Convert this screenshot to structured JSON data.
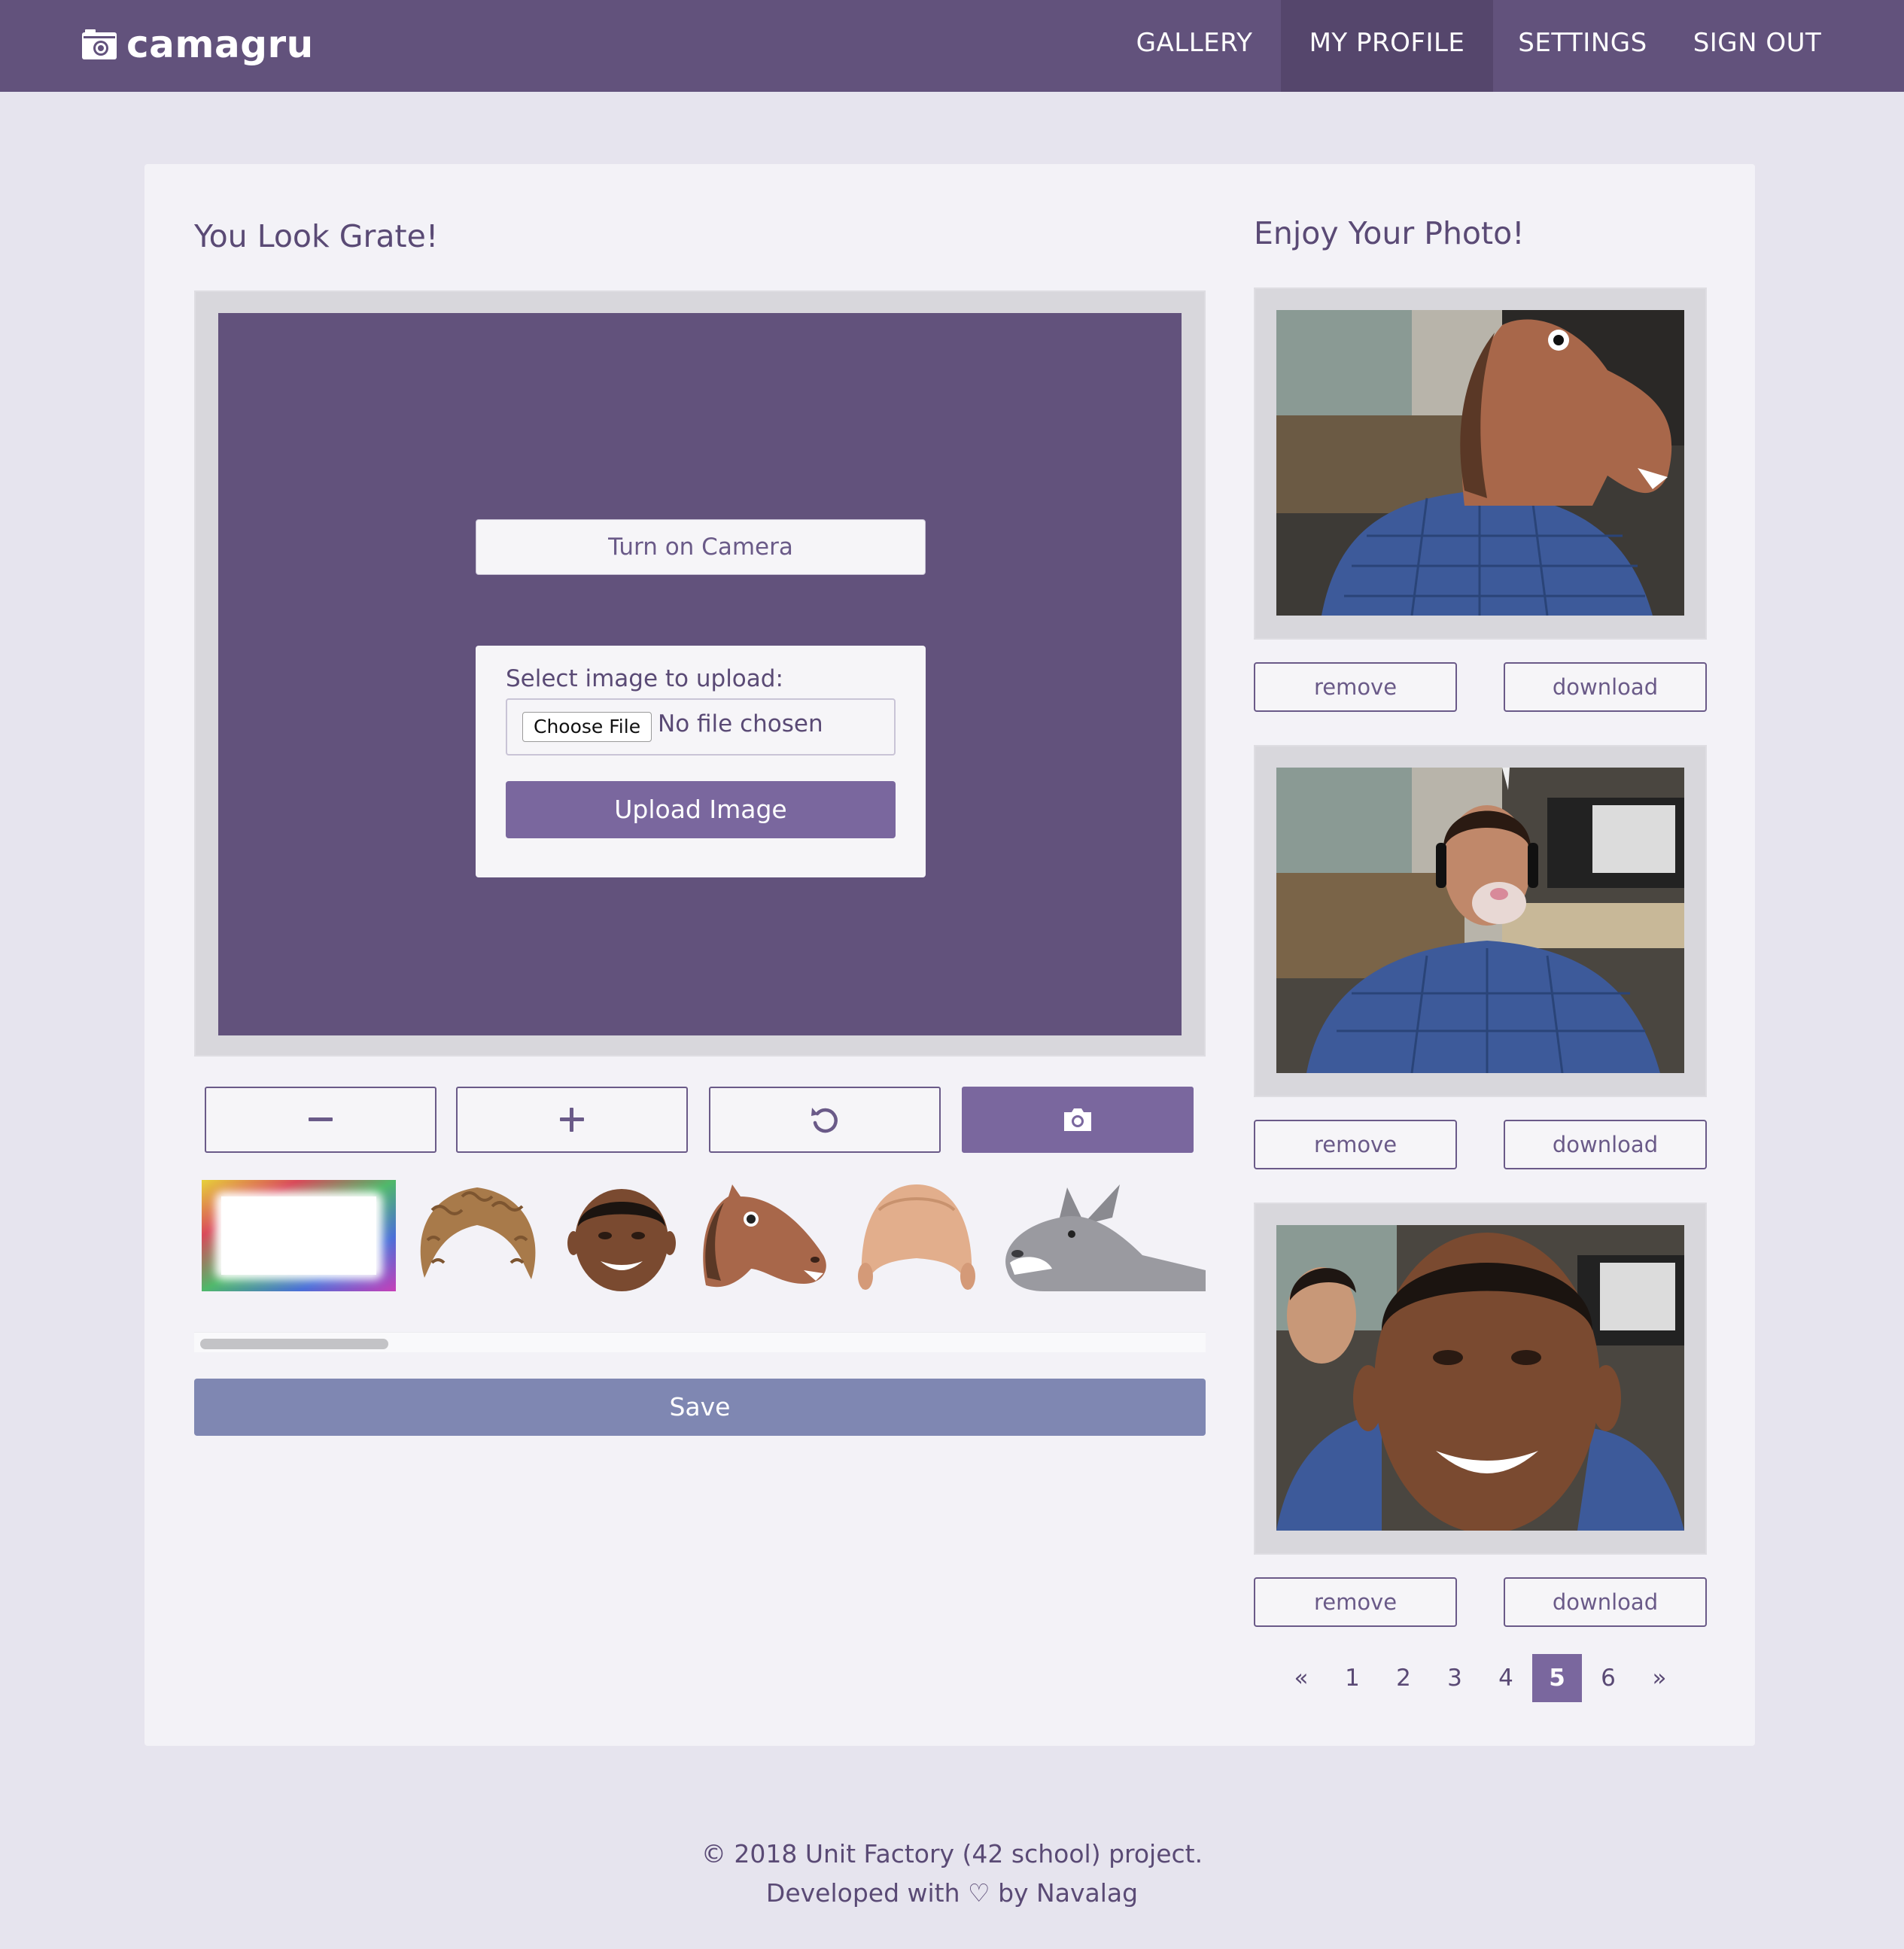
{
  "brand": {
    "name": "camagru",
    "logo_icon": "camera-icon"
  },
  "nav": [
    {
      "label": "GALLERY",
      "active": false
    },
    {
      "label": "MY PROFILE",
      "active": true
    },
    {
      "label": "SETTINGS",
      "active": false
    },
    {
      "label": "SIGN OUT",
      "active": false
    }
  ],
  "editor": {
    "title": "You Look Grate!",
    "camera_button": "Turn on Camera",
    "upload": {
      "label": "Select image to upload:",
      "choose_button": "Choose File",
      "file_status": "No file chosen",
      "upload_button": "Upload Image"
    },
    "controls": [
      {
        "name": "zoom-out",
        "icon": "minus-icon"
      },
      {
        "name": "zoom-in",
        "icon": "plus-icon"
      },
      {
        "name": "reset",
        "icon": "rotate-ccw-icon"
      },
      {
        "name": "capture",
        "icon": "camera-icon"
      }
    ],
    "stickers": [
      "rainbow-frame",
      "curly-wig",
      "celebrity-face",
      "horse-mask",
      "bald-cap",
      "donkey-head"
    ],
    "save_button": "Save"
  },
  "gallery": {
    "title": "Enjoy Your Photo!",
    "photos": [
      {
        "overlay": "horse-mask",
        "remove_label": "remove",
        "download_label": "download"
      },
      {
        "overlay": "bunny-nose",
        "remove_label": "remove",
        "download_label": "download"
      },
      {
        "overlay": "celebrity-face",
        "remove_label": "remove",
        "download_label": "download"
      }
    ],
    "pagination": {
      "prev": "«",
      "pages": [
        "1",
        "2",
        "3",
        "4",
        "5",
        "6"
      ],
      "current": "5",
      "next": "»"
    }
  },
  "footer": {
    "line1": "© 2018 Unit Factory (42 school) project.",
    "line2": "Developed with ♡ by Navalag"
  },
  "colors": {
    "primary": "#62527c",
    "accent": "#7a679e",
    "save": "#7f87b2",
    "background": "#e6e4ee",
    "card": "#f3f2f7"
  }
}
